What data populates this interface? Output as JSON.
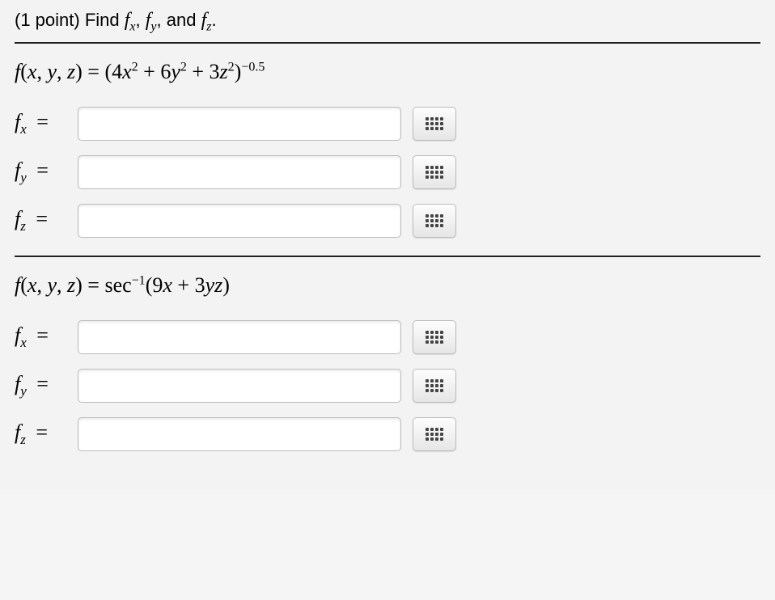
{
  "prompt": {
    "prefix": "(1 point) Find ",
    "f1": "f",
    "sub1": "x",
    "comma1": ", ",
    "f2": "f",
    "sub2": "y",
    "comma2": ", and ",
    "f3": "f",
    "sub3": "z",
    "period": "."
  },
  "part1": {
    "expr_html": "<span class='it'>f</span>(<span class='it'>x</span>, <span class='it'>y</span>, <span class='it'>z</span>) = (4<span class='it'>x</span><sup>2</sup> + 6<span class='it'>y</span><sup>2</sup> + 3<span class='it'>z</span><sup>2</sup>)<sup><span class='neg'>&minus;0.5</span></sup>",
    "labels": {
      "fx": "x",
      "fy": "y",
      "fz": "z"
    }
  },
  "part2": {
    "expr_html": "<span class='it'>f</span>(<span class='it'>x</span>, <span class='it'>y</span>, <span class='it'>z</span>) = sec<sup>&minus;1</sup>(9<span class='it'>x</span> + 3<span class='it'>yz</span>)",
    "labels": {
      "fx": "x",
      "fy": "y",
      "fz": "z"
    }
  },
  "inputs": {
    "p1_fx": "",
    "p1_fy": "",
    "p1_fz": "",
    "p2_fx": "",
    "p2_fy": "",
    "p2_fz": ""
  }
}
